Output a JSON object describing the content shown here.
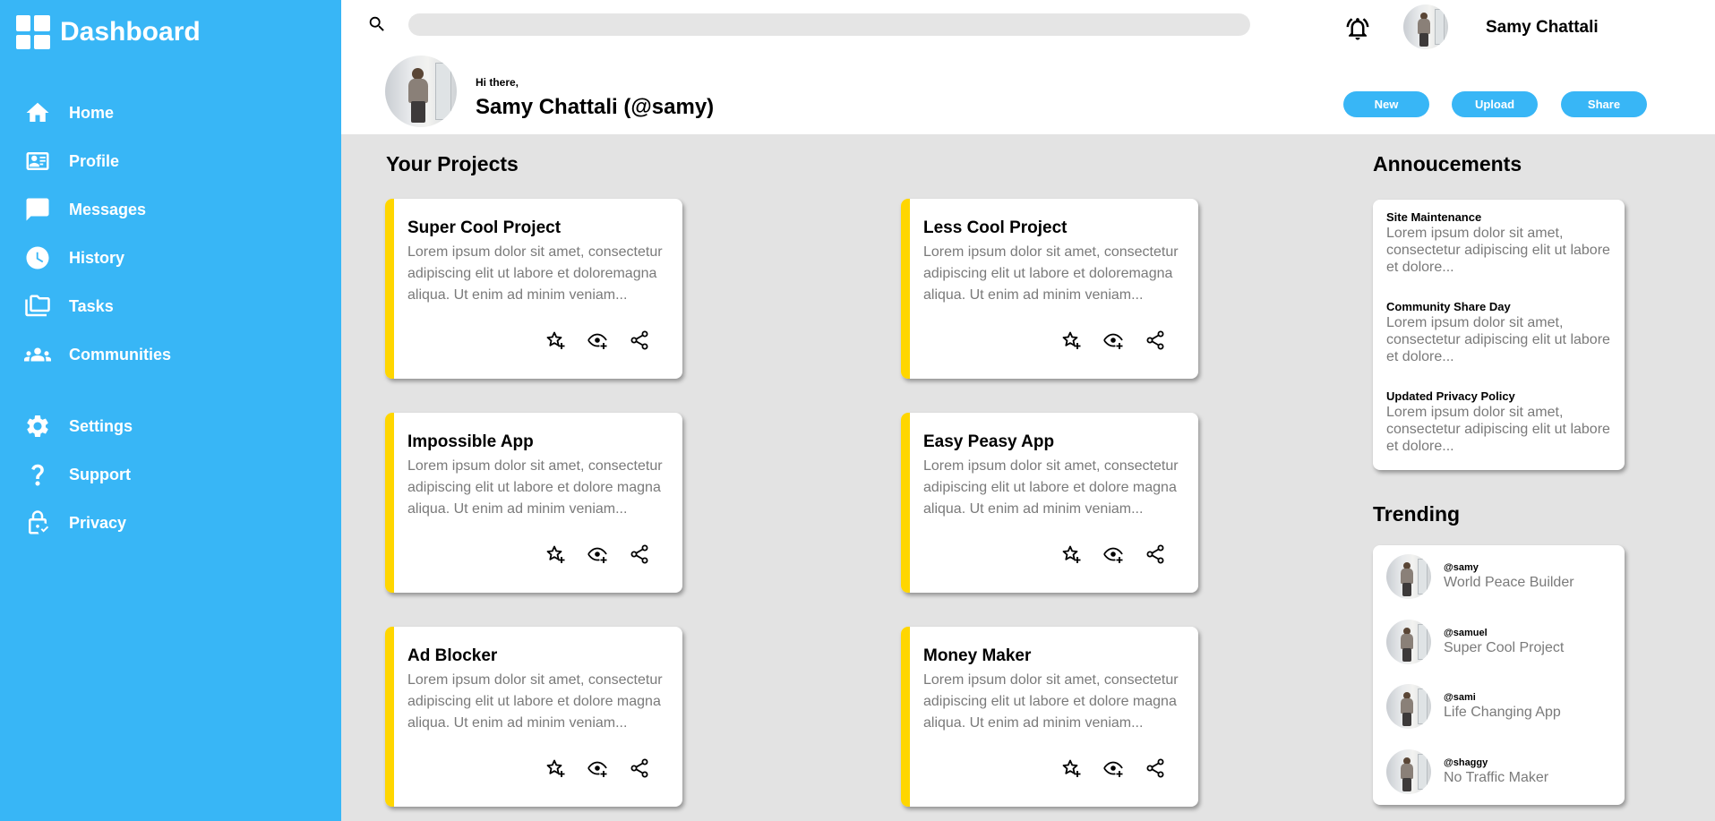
{
  "brand": {
    "title": "Dashboard"
  },
  "colors": {
    "sidebar": "#38b6f6",
    "accent": "#ffd600",
    "background": "#e3e3e3"
  },
  "sidebar": {
    "items": [
      {
        "label": "Home",
        "icon": "home-icon"
      },
      {
        "label": "Profile",
        "icon": "id-card-icon"
      },
      {
        "label": "Messages",
        "icon": "chat-bubble-icon"
      },
      {
        "label": "History",
        "icon": "clock-icon"
      },
      {
        "label": "Tasks",
        "icon": "folders-icon"
      },
      {
        "label": "Communities",
        "icon": "people-icon"
      },
      {
        "label": "Settings",
        "icon": "gear-icon"
      },
      {
        "label": "Support",
        "icon": "question-icon"
      },
      {
        "label": "Privacy",
        "icon": "lock-icon"
      }
    ]
  },
  "header": {
    "search": {
      "value": "",
      "placeholder": ""
    },
    "username": "Samy Chattali",
    "greeting": "Hi there,",
    "display_name": "Samy Chattali (@samy)",
    "buttons": [
      "New",
      "Upload",
      "Share"
    ]
  },
  "projects": {
    "title": "Your Projects",
    "items": [
      {
        "title": "Super Cool Project",
        "description": "Lorem ipsum dolor sit amet, consectetur adipiscing elit ut labore et doloremagna aliqua. Ut enim ad minim veniam..."
      },
      {
        "title": "Less Cool Project",
        "description": "Lorem ipsum dolor sit amet, consectetur adipiscing elit ut labore et doloremagna aliqua. Ut enim ad minim veniam..."
      },
      {
        "title": "Impossible App",
        "description": "Lorem ipsum dolor sit amet, consectetur adipiscing elit ut labore et dolore magna aliqua. Ut enim ad minim veniam..."
      },
      {
        "title": "Easy Peasy App",
        "description": "Lorem ipsum dolor sit amet, consectetur adipiscing elit ut labore et dolore magna aliqua. Ut enim ad minim veniam..."
      },
      {
        "title": "Ad Blocker",
        "description": "Lorem ipsum dolor sit amet, consectetur adipiscing elit ut labore et dolore magna aliqua. Ut enim ad minim veniam..."
      },
      {
        "title": "Money Maker",
        "description": "Lorem ipsum dolor sit amet, consectetur adipiscing elit ut labore et dolore magna aliqua. Ut enim ad minim veniam..."
      }
    ]
  },
  "announcements": {
    "title": "Annoucements",
    "items": [
      {
        "title": "Site Maintenance",
        "description": "Lorem ipsum dolor sit amet, consectetur adipiscing elit ut labore et dolore..."
      },
      {
        "title": "Community Share Day",
        "description": "Lorem ipsum dolor sit amet, consectetur adipiscing elit ut labore et dolore..."
      },
      {
        "title": "Updated Privacy Policy",
        "description": "Lorem ipsum dolor sit amet, consectetur adipiscing elit ut labore et dolore..."
      }
    ]
  },
  "trending": {
    "title": "Trending",
    "items": [
      {
        "handle": "@samy",
        "title": "World Peace Builder"
      },
      {
        "handle": "@samuel",
        "title": "Super Cool Project"
      },
      {
        "handle": "@sami",
        "title": "Life Changing App"
      },
      {
        "handle": "@shaggy",
        "title": "No Traffic Maker"
      }
    ]
  }
}
